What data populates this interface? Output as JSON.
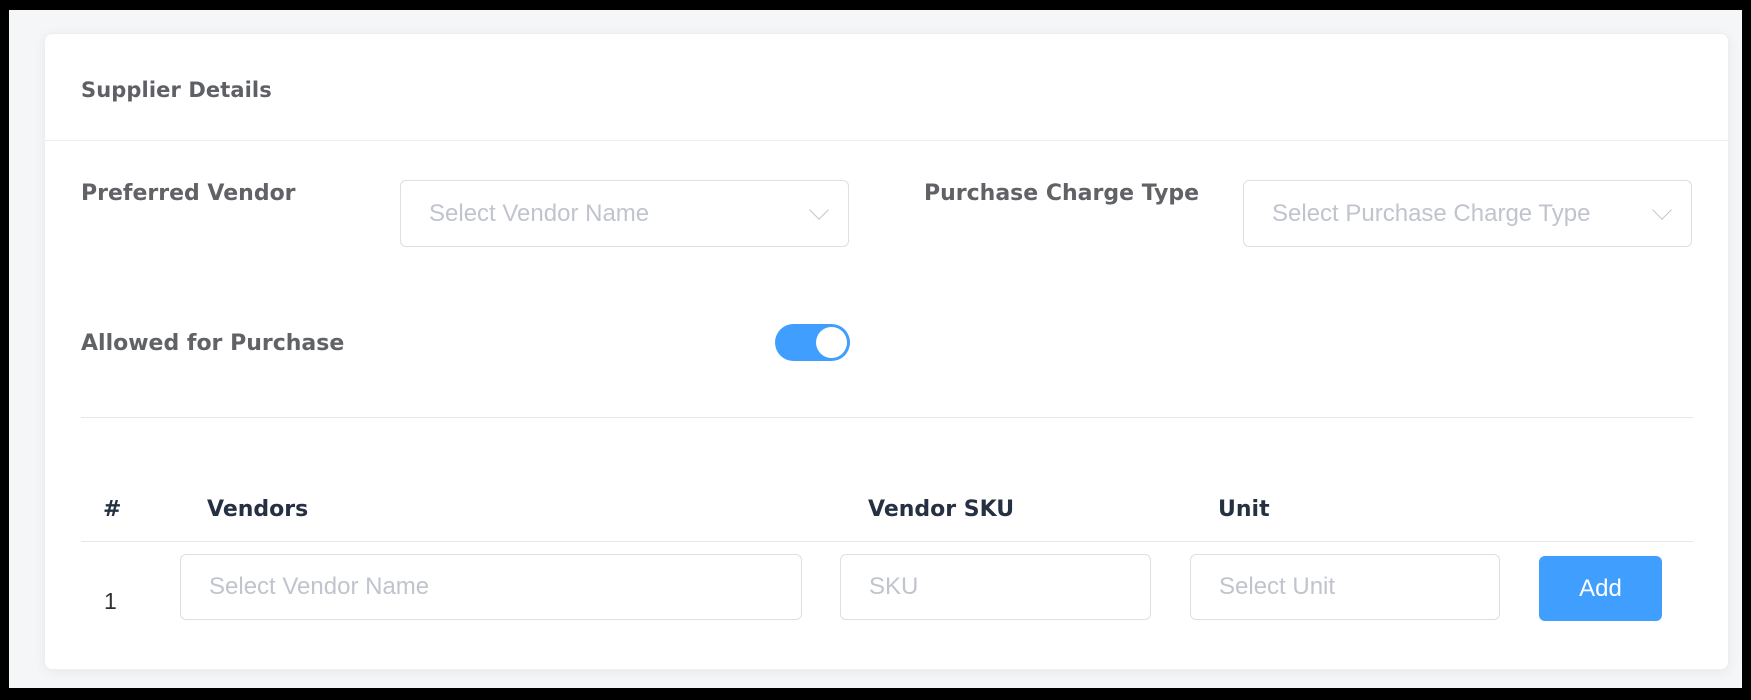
{
  "card": {
    "title": "Supplier Details"
  },
  "form": {
    "preferred_vendor": {
      "label": "Preferred Vendor",
      "placeholder": "Select Vendor Name"
    },
    "purchase_charge_type": {
      "label": "Purchase Charge Type",
      "placeholder": "Select Purchase Charge Type"
    },
    "allowed_for_purchase": {
      "label": "Allowed for Purchase",
      "enabled": true
    }
  },
  "table": {
    "headers": [
      "#",
      "Vendors",
      "Vendor SKU",
      "Unit"
    ],
    "rows": [
      {
        "index": "1",
        "vendor_placeholder": "Select Vendor Name",
        "sku_placeholder": "SKU",
        "unit_placeholder": "Select Unit",
        "action_label": "Add"
      }
    ]
  },
  "colors": {
    "accent": "#409eff",
    "label": "#606266",
    "header_text": "#253142",
    "placeholder": "#c0c4cc",
    "border": "#dcdfe6"
  }
}
